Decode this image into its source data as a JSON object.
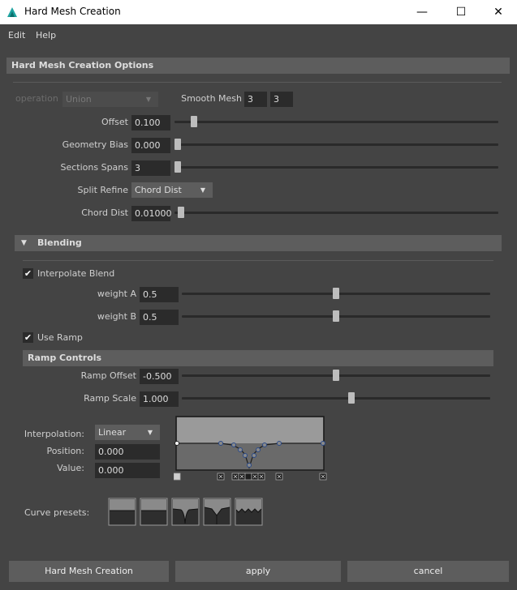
{
  "window": {
    "title": "Hard Mesh Creation",
    "minimize_glyph": "—",
    "maximize_glyph": "☐",
    "close_glyph": "✕"
  },
  "menu": {
    "items": [
      "Edit",
      "Help"
    ]
  },
  "options_header": "Hard Mesh Creation Options",
  "operation": {
    "label": "operation",
    "value": "Union"
  },
  "smooth_mesh": {
    "label": "Smooth Mesh",
    "value1": "3",
    "value2": "3"
  },
  "offset": {
    "label": "Offset",
    "value": "0.100",
    "slider_fraction": 0.05
  },
  "geometry_bias": {
    "label": "Geometry Bias",
    "value": "0.000",
    "slider_fraction": 0.0
  },
  "sections_spans": {
    "label": "Sections Spans",
    "value": "3",
    "slider_fraction": 0.0
  },
  "split_refine": {
    "label": "Split Refine",
    "value": "Chord Dist"
  },
  "chord_dist": {
    "label": "Chord Dist",
    "value": "0.01000",
    "slider_fraction": 0.01
  },
  "blending": {
    "header": "Blending",
    "interpolate_blend": {
      "label": "Interpolate Blend",
      "checked": true
    },
    "weight_a": {
      "label": "weight A",
      "value": "0.5",
      "slider_fraction": 0.5
    },
    "weight_b": {
      "label": "weight B",
      "value": "0.5",
      "slider_fraction": 0.5
    },
    "use_ramp": {
      "label": "Use Ramp",
      "checked": true
    }
  },
  "ramp": {
    "header": "Ramp Controls",
    "offset": {
      "label": "Ramp Offset",
      "value": "-0.500",
      "slider_fraction": 0.5
    },
    "scale": {
      "label": "Ramp Scale",
      "value": "1.000",
      "slider_fraction": 0.55
    },
    "interpolation": {
      "label": "Interpolation:",
      "value": "Linear"
    },
    "position": {
      "label": "Position:",
      "value": "0.000"
    },
    "value": {
      "label": "Value:",
      "value": "0.000"
    },
    "curve_presets_label": "Curve presets:"
  },
  "buttons": {
    "create": "Hard Mesh Creation",
    "apply": "apply",
    "cancel": "cancel"
  },
  "icons": {
    "dropdown_arrow": "▼",
    "collapse_arrow": "▼",
    "check": "✔"
  },
  "colors": {
    "background": "#444444",
    "header": "#5d5d5d",
    "field": "#2b2b2b",
    "accent_app_icon": "#1fa3a0"
  }
}
